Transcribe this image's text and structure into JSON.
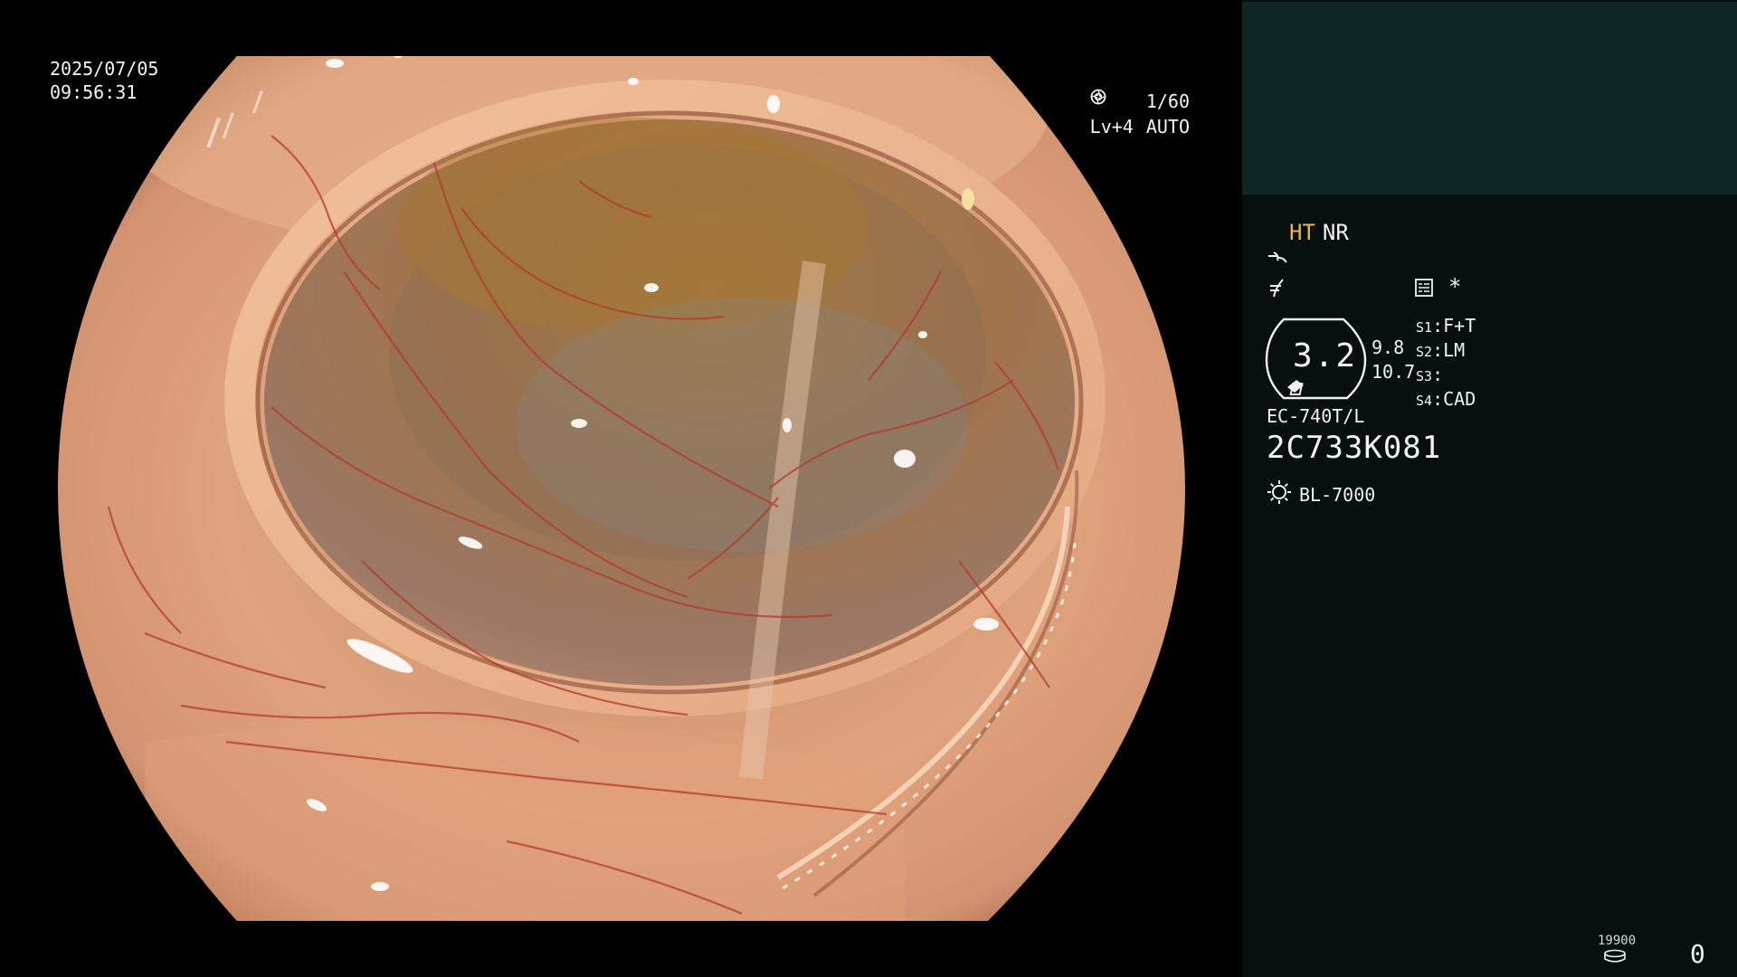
{
  "overlay": {
    "date": "2025/07/05",
    "time": "09:56:31",
    "shutter": "1/60",
    "level": "Lv+4",
    "mode": "AUTO"
  },
  "panel": {
    "mode_ht": "HT",
    "mode_nr": "NR",
    "asterisk": "*",
    "scope_value": "3.2",
    "diameter_1": "9.8",
    "diameter_2": "10.7",
    "switches": [
      {
        "key": "S1",
        "value": "F+T"
      },
      {
        "key": "S2",
        "value": "LM"
      },
      {
        "key": "S3",
        "value": ""
      },
      {
        "key": "S4",
        "value": "CAD"
      }
    ],
    "scope_model": "EC-740T/L",
    "scope_serial": "2C733K081",
    "light_source": "BL-7000",
    "counter_small": "19900",
    "counter_big": "0"
  },
  "colors": {
    "panel_bg": "#06110f",
    "preview_bg": "#0e2624",
    "ht_accent": "#e8b74a",
    "mucosa": "#d99a6e",
    "vessel": "#b53a2c"
  },
  "icons": {
    "shutter": "aperture-icon",
    "auto": "iris-icon",
    "enhance_1": "structure-enhance-icon",
    "enhance_2": "color-enhance-icon",
    "memory": "memory-card-icon",
    "light": "light-source-icon",
    "counter": "disc-stack-icon"
  }
}
